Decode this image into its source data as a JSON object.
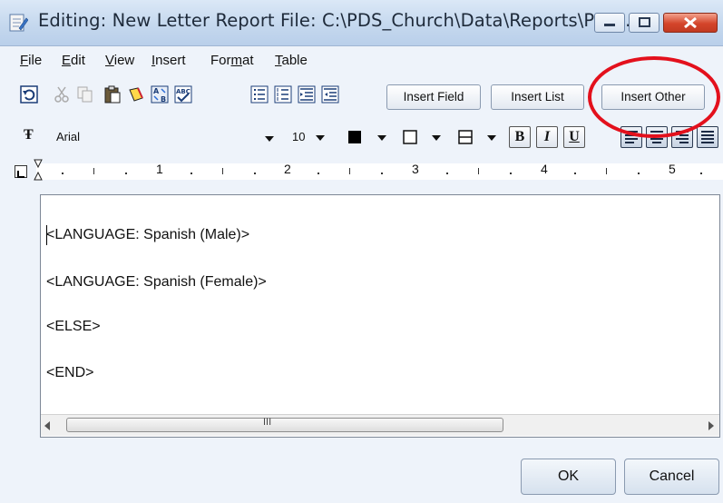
{
  "window": {
    "title": "Editing: New Letter Report   File: C:\\PDS_Church\\Data\\Reports\\PDS...",
    "icon": "document-edit-icon"
  },
  "menu": [
    {
      "label": "File",
      "mnemonic": "F"
    },
    {
      "label": "Edit",
      "mnemonic": "E"
    },
    {
      "label": "View",
      "mnemonic": "V"
    },
    {
      "label": "Insert",
      "mnemonic": "I"
    },
    {
      "label": "Format",
      "mnemonic": "m"
    },
    {
      "label": "Table",
      "mnemonic": "T"
    }
  ],
  "toolbar": {
    "icons": [
      "undo-icon",
      "cut-icon",
      "copy-icon",
      "paste-icon",
      "format-painter-icon",
      "find-replace-icon",
      "spellcheck-icon",
      "bullet-list-icon",
      "numbered-list-icon",
      "indent-icon",
      "outdent-icon"
    ],
    "insert_field": "Insert Field",
    "insert_list": "Insert List",
    "insert_other": "Insert Other"
  },
  "format_bar": {
    "font": "Arial",
    "size": "10",
    "bold": "B",
    "italic": "I",
    "underline": "U"
  },
  "ruler": {
    "numbers": [
      "1",
      "2",
      "3",
      "4",
      "5"
    ]
  },
  "document": {
    "lines": [
      "<LANGUAGE: Spanish (Male)>",
      "<LANGUAGE: Spanish (Female)>",
      "<ELSE>",
      "<END>"
    ]
  },
  "scrollbar": {
    "grip": "III"
  },
  "buttons": {
    "ok": "OK",
    "cancel": "Cancel"
  },
  "colors": {
    "highlight_circle": "#e3101c",
    "title_bar": "#c5d8ee",
    "close_button": "#d4452b"
  }
}
